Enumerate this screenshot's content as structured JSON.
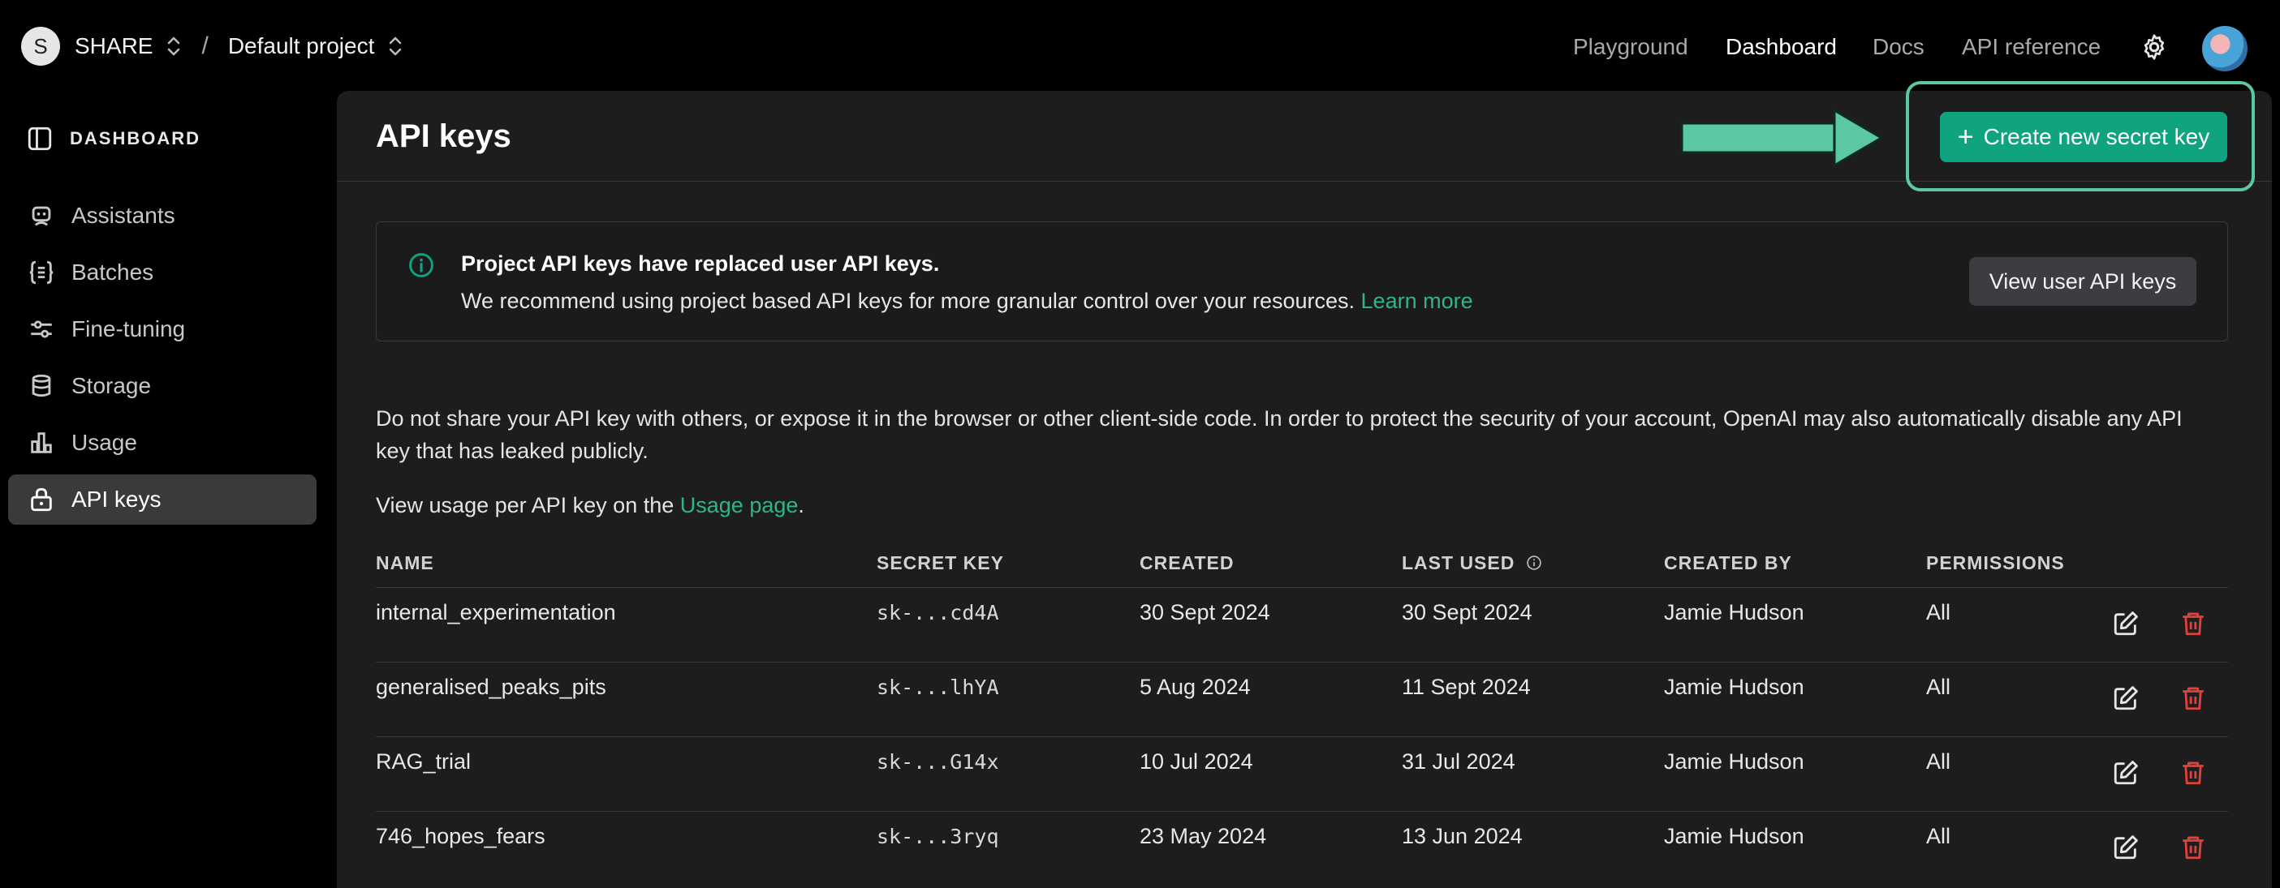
{
  "topbar": {
    "org_initial": "S",
    "org_name": "SHARE",
    "separator": "/",
    "project_name": "Default project",
    "nav": [
      "Playground",
      "Dashboard",
      "Docs",
      "API reference"
    ],
    "active_nav": "Dashboard"
  },
  "sidebar": {
    "header": "DASHBOARD",
    "items": [
      {
        "label": "Assistants",
        "icon": "robot-icon"
      },
      {
        "label": "Batches",
        "icon": "braces-list-icon"
      },
      {
        "label": "Fine-tuning",
        "icon": "sliders-icon"
      },
      {
        "label": "Storage",
        "icon": "database-icon"
      },
      {
        "label": "Usage",
        "icon": "bar-chart-icon"
      },
      {
        "label": "API keys",
        "icon": "lock-icon"
      }
    ],
    "active": "API keys"
  },
  "main": {
    "title": "API keys",
    "create_button": "Create new secret key",
    "notice": {
      "heading": "Project API keys have replaced user API keys.",
      "body": "We recommend using project based API keys for more granular control over your resources.",
      "link": "Learn more",
      "button": "View user API keys"
    },
    "warning_line1": "Do not share your API key with others, or expose it in the browser or other client-side code. In order to protect the security of your account, OpenAI may also automatically disable any API",
    "warning_line2": "key that has leaked publicly.",
    "usage_prefix": "View usage per API key on the",
    "usage_link": "Usage page",
    "usage_suffix": "."
  },
  "table": {
    "headers": [
      "NAME",
      "SECRET KEY",
      "CREATED",
      "LAST USED",
      "CREATED BY",
      "PERMISSIONS"
    ],
    "rows": [
      {
        "name": "internal_experimentation",
        "key": "sk-...cd4A",
        "created": "30 Sept 2024",
        "last_used": "30 Sept 2024",
        "created_by": "Jamie Hudson",
        "permissions": "All"
      },
      {
        "name": "generalised_peaks_pits",
        "key": "sk-...lhYA",
        "created": "5 Aug 2024",
        "last_used": "11 Sept 2024",
        "created_by": "Jamie Hudson",
        "permissions": "All"
      },
      {
        "name": "RAG_trial",
        "key": "sk-...G14x",
        "created": "10 Jul 2024",
        "last_used": "31 Jul 2024",
        "created_by": "Jamie Hudson",
        "permissions": "All"
      },
      {
        "name": "746_hopes_fears",
        "key": "sk-...3ryq",
        "created": "23 May 2024",
        "last_used": "13 Jun 2024",
        "created_by": "Jamie Hudson",
        "permissions": "All"
      }
    ]
  },
  "colors": {
    "accent": "#10a37f",
    "highlight": "#5bc7a5",
    "delete": "#e0423b",
    "background": "#000000",
    "panel": "#1d1d1e"
  }
}
